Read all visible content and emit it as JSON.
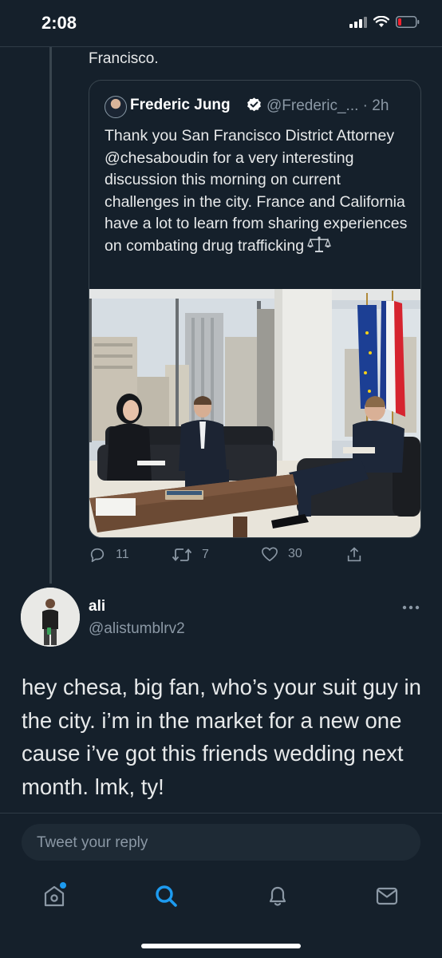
{
  "status_bar": {
    "time": "2:08",
    "battery_color": "#f4212e"
  },
  "previous_tweet": {
    "text_tail": "Francisco."
  },
  "quoted_tweet": {
    "author_name": "Frederic Jung",
    "handle": "@Frederic_...",
    "time": "· 2h",
    "verified": true,
    "text": "Thank you San Francisco District Attorney @chesaboudin for a very interesting discussion this morning on current challenges in the city. France and California have a lot to learn from sharing experiences on combating drug trafficking",
    "emoji_icon": "scales-icon",
    "photo": "office-meeting-photo"
  },
  "actions": {
    "replies": "11",
    "retweets": "7",
    "likes": "30"
  },
  "reply": {
    "name": "ali",
    "handle": "@alistumblrv2",
    "text": "hey chesa, big fan, who’s your suit guy in the city. i’m in the market for a new one cause i’ve got this friends wedding next month. lmk, ty!"
  },
  "composer": {
    "placeholder": "Tweet your reply"
  },
  "tabbar": {
    "items": [
      "home-icon",
      "search-icon",
      "notifications-icon",
      "messages-icon"
    ],
    "active": "search-icon",
    "accent_color": "#1d9bf0"
  },
  "colors": {
    "background": "#15202b",
    "muted_text": "#8b98a5",
    "border": "#38444d"
  }
}
